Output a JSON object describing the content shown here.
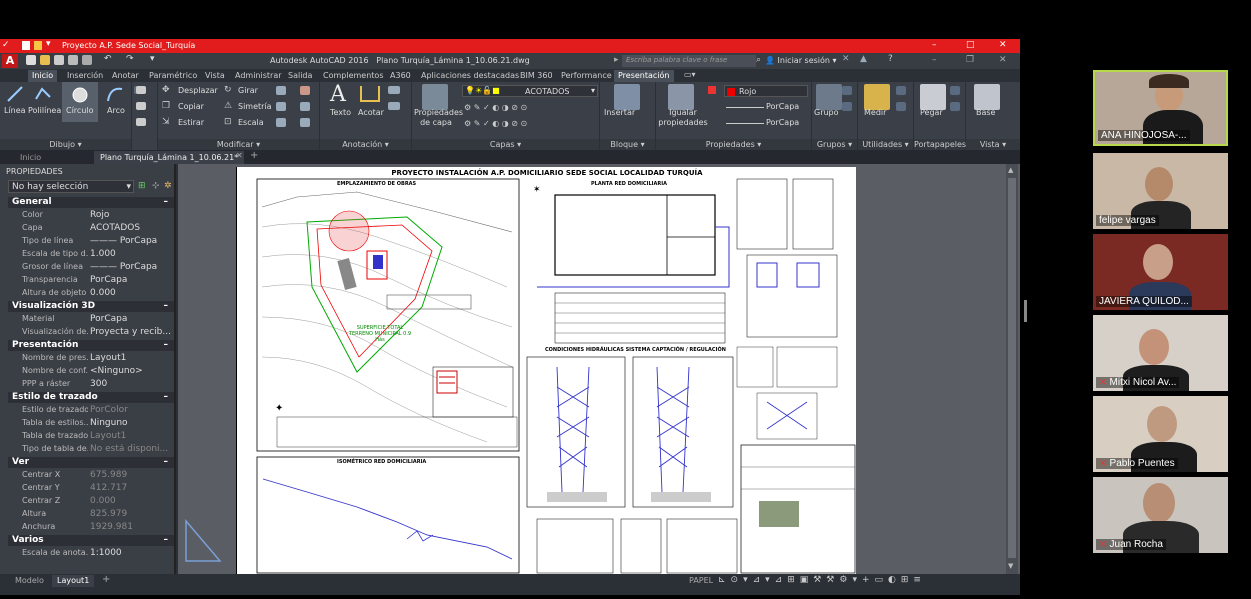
{
  "titlebar": {
    "title": "Proyecto A.P. Sede Social_Turquía"
  },
  "app": {
    "name": "Autodesk AutoCAD 2016",
    "file": "Plano Turquía_Lámina 1_10.06.21.dwg",
    "search_placeholder": "Escriba palabra clave o frase",
    "login": "Iniciar sesión"
  },
  "ribbon_tabs": [
    "Inicio",
    "Inserción",
    "Anotar",
    "Paramétrico",
    "Vista",
    "Administrar",
    "Salida",
    "Complementos",
    "A360",
    "Aplicaciones destacadas",
    "BIM 360",
    "Performance",
    "Presentación"
  ],
  "ribbon": {
    "dibujo": {
      "linea": "Línea",
      "polilinea": "Polilínea",
      "circulo": "Círculo",
      "arco": "Arco",
      "panel": "Dibujo ▾"
    },
    "modificar": {
      "desplazar": "Desplazar",
      "girar": "Girar",
      "copiar": "Copiar",
      "simetria": "Simetría",
      "estirar": "Estirar",
      "escala": "Escala",
      "panel": "Modificar ▾"
    },
    "anotacion": {
      "texto": "Texto",
      "acotar": "Acotar",
      "panel": "Anotación ▾"
    },
    "capas": {
      "propiedades": "Propiedades de capa",
      "current": "ACOTADOS",
      "panel": "Capas ▾"
    },
    "bloque": {
      "insertar": "Insertar",
      "panel": "Bloque ▾"
    },
    "propiedades": {
      "igualar": "Igualar propiedades",
      "color": "Rojo",
      "linetype": "PorCapa",
      "lineweight": "PorCapa",
      "panel": "Propiedades ▾"
    },
    "grupos": {
      "grupo": "Grupo",
      "panel": "Grupos ▾"
    },
    "utilidades": {
      "medir": "Medir",
      "panel": "Utilidades ▾"
    },
    "portapapeles": {
      "pegar": "Pegar",
      "panel": "Portapapeles"
    },
    "vista": {
      "base": "Base",
      "panel": "Vista ▾"
    }
  },
  "doc_tabs": [
    "Inicio",
    "Plano Turquía_Lámina 1_10.06.21*"
  ],
  "properties": {
    "header": "PROPIEDADES",
    "selection": "No hay selección",
    "sections": {
      "general": "General",
      "viz3d": "Visualización 3D",
      "presentacion": "Presentación",
      "trazado": "Estilo de trazado",
      "ver": "Ver",
      "varios": "Varios"
    },
    "general": [
      {
        "k": "Color",
        "v": "Rojo"
      },
      {
        "k": "Capa",
        "v": "ACOTADOS"
      },
      {
        "k": "Tipo de línea",
        "v": "——— PorCapa"
      },
      {
        "k": "Escala de tipo d...",
        "v": "1.000"
      },
      {
        "k": "Grosor de línea",
        "v": "——— PorCapa"
      },
      {
        "k": "Transparencia",
        "v": "PorCapa"
      },
      {
        "k": "Altura de objeto",
        "v": "0.000"
      }
    ],
    "viz3d": [
      {
        "k": "Material",
        "v": "PorCapa"
      },
      {
        "k": "Visualización de...",
        "v": "Proyecta y recib..."
      }
    ],
    "presentacion": [
      {
        "k": "Nombre de pres...",
        "v": "Layout1"
      },
      {
        "k": "Nombre de conf...",
        "v": "<Ninguno>"
      },
      {
        "k": "PPP a ráster",
        "v": "300"
      }
    ],
    "trazado": [
      {
        "k": "Estilo de trazado",
        "v": "PorColor"
      },
      {
        "k": "Tabla de estilos...",
        "v": "Ninguno"
      },
      {
        "k": "Tabla de trazado...",
        "v": "Layout1"
      },
      {
        "k": "Tipo de tabla de...",
        "v": "No está disponi..."
      }
    ],
    "ver": [
      {
        "k": "Centrar X",
        "v": "675.989"
      },
      {
        "k": "Centrar Y",
        "v": "412.717"
      },
      {
        "k": "Centrar Z",
        "v": "0.000"
      },
      {
        "k": "Altura",
        "v": "825.979"
      },
      {
        "k": "Anchura",
        "v": "1929.981"
      }
    ],
    "varios": [
      {
        "k": "Escala de anota...",
        "v": "1:1000"
      }
    ]
  },
  "drawing": {
    "title": "PROYECTO INSTALACIÓN A.P. DOMICILIARIO SEDE SOCIAL LOCALIDAD TURQUÍA",
    "emplazamiento": "EMPLAZAMIENTO DE OBRAS",
    "planta": "PLANTA RED DOMICILIARIA",
    "superficie": "SUPERFICIE TOTAL TERRENO MUNICIPAL 0.9 Hás",
    "condiciones": "CONDICIONES HIDRÁULICAS SISTEMA CAPTACIÓN / REGULACIÓN",
    "isometrico": "ISOMÉTRICO RED DOMICILIARIA"
  },
  "layout_tabs": [
    "Modelo",
    "Layout1"
  ],
  "status": {
    "papel": "PAPEL"
  },
  "participants": [
    {
      "name": "ANA HINOJOSA-...",
      "muted": false
    },
    {
      "name": "felipe vargas",
      "muted": false
    },
    {
      "name": "JAVIERA QUILOD...",
      "muted": false
    },
    {
      "name": "Mitxi Nicol Av...",
      "muted": true
    },
    {
      "name": "Pablo Puentes",
      "muted": true
    },
    {
      "name": "Juan Rocha",
      "muted": true
    }
  ],
  "colors": {
    "autocad_red": "#e21c1c",
    "active_speaker": "#b6d84a",
    "mic_muted": "#e33333"
  }
}
